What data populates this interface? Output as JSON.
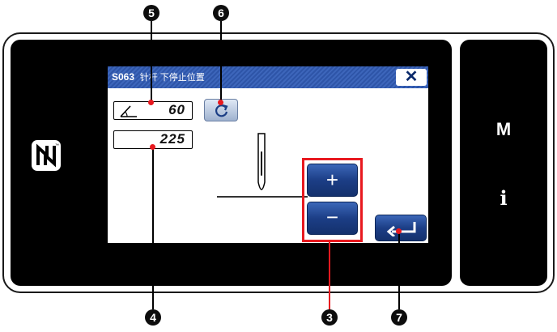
{
  "panel": {
    "title": "S063",
    "title_jp": "针杆 下停止位置",
    "close_glyph": "✕",
    "angle_value": "60",
    "count_value": "225",
    "plus_label": "+",
    "minus_label": "−",
    "side_keys": {
      "m": "M",
      "i": "i"
    }
  },
  "callouts": {
    "c5": "5",
    "c6": "6",
    "c4": "4",
    "c3": "3",
    "c7": "7"
  },
  "icons": {
    "nfc": "nfc-icon",
    "angle": "angle-icon",
    "reset": "reset-icon",
    "enter": "enter-icon",
    "needle": "needle-icon"
  },
  "colors": {
    "title_bar": "#2e55a8",
    "button_blue": "#1c3e86",
    "highlight_red": "#e8191f",
    "bezel": "#000000"
  }
}
